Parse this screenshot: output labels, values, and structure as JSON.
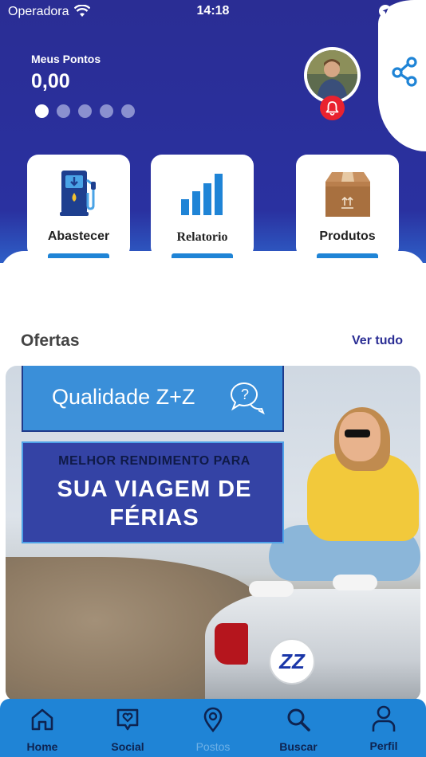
{
  "status_bar": {
    "carrier": "Operadora",
    "time": "14:18",
    "icons": [
      "wifi-icon",
      "location-arrow-icon",
      "battery-icon"
    ]
  },
  "header": {
    "points_label": "Meus Pontos",
    "points_value": "0,00",
    "carousel_dots": 5,
    "active_dot": 0,
    "colors": {
      "primary": "#2a2d94",
      "accent": "#1f84d6",
      "alert": "#e9222f"
    }
  },
  "quick_actions": [
    {
      "label": "Abastecer",
      "icon": "fuel-pump-icon"
    },
    {
      "label": "Relatorio",
      "icon": "bar-chart-icon"
    },
    {
      "label": "Produtos",
      "icon": "box-icon"
    }
  ],
  "offers": {
    "title": "Ofertas",
    "see_all": "Ver tudo",
    "banner": {
      "headline": "Qualidade Z+Z",
      "subline": "MELHOR RENDIMENTO PARA",
      "line1": "SUA VIAGEM DE",
      "line2": "FÉRIAS",
      "logo_text": "ZZ"
    }
  },
  "bottom_nav": [
    {
      "label": "Home",
      "icon": "home-icon",
      "active": true
    },
    {
      "label": "Social",
      "icon": "heart-chat-icon",
      "active": false
    },
    {
      "label": "Postos",
      "icon": "map-pin-icon",
      "active": false
    },
    {
      "label": "Buscar",
      "icon": "search-icon",
      "active": false
    },
    {
      "label": "Perfil",
      "icon": "user-icon",
      "active": false
    }
  ]
}
